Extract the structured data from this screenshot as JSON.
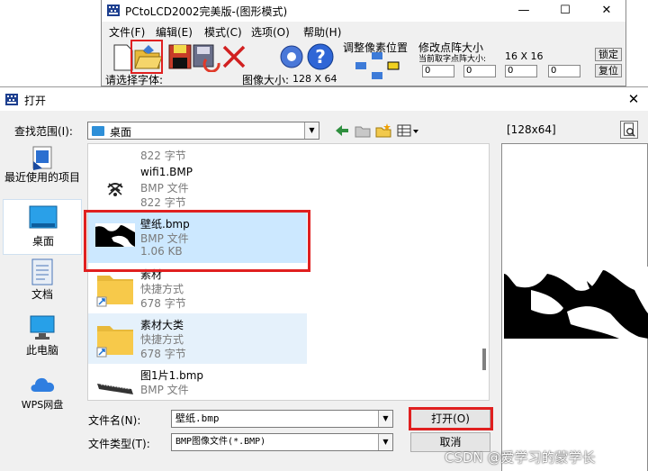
{
  "background_app": {
    "title": "PCtoLCD2002完美版-(图形模式)",
    "window_controls": [
      "—",
      "☐",
      "✕"
    ],
    "menu": [
      "文件(F)",
      "编辑(E)",
      "模式(C)",
      "选项(O)",
      "帮助(H)"
    ],
    "adjust_label": "调整像素位置",
    "resize_label": "修改点阵大小",
    "current_size_label": "当前取字点阵大小:",
    "current_size_value": "16 X 16",
    "lock_button": "锁定",
    "restore_button": "复位",
    "spin_values": [
      "0",
      "0",
      "0",
      "0"
    ],
    "status_font_label": "请选择字体:",
    "status_size_label": "图像大小:",
    "status_size_value": "128 X 64"
  },
  "dialog": {
    "title": "打开",
    "close_glyph": "✕",
    "look_in_label": "查找范围(I):",
    "look_in_value": "桌面",
    "preview_label": "[128x64]",
    "places": [
      {
        "label": "最近使用的项目",
        "icon": "recent-icon"
      },
      {
        "label": "桌面",
        "icon": "desktop-icon",
        "selected": true
      },
      {
        "label": "文档",
        "icon": "documents-icon"
      },
      {
        "label": "此电脑",
        "icon": "computer-icon"
      },
      {
        "label": "WPS网盘",
        "icon": "cloud-icon"
      }
    ],
    "files": [
      {
        "size": "822 字节"
      },
      {
        "name": "wifi1.BMP",
        "type": "BMP 文件",
        "size": "822 字节"
      },
      {
        "name": "壁纸.bmp",
        "type": "BMP 文件",
        "size": "1.06 KB"
      },
      {
        "name": "素材",
        "type": "快捷方式",
        "size": "678 字节"
      },
      {
        "name": "素材大类",
        "type": "快捷方式",
        "size": "678 字节"
      },
      {
        "name": "图1片1.bmp",
        "type": "BMP 文件"
      }
    ],
    "file_name_label": "文件名(N):",
    "file_name_value": "壁纸.bmp",
    "file_type_label": "文件类型(T):",
    "file_type_value": "BMP图像文件(*.BMP)",
    "open_button": "打开(O)",
    "cancel_button": "取消",
    "watermark": "CSDN @爱学习的蒙学长"
  },
  "colors": {
    "highlight_red": "#e02020",
    "selection_blue": "#cce8ff",
    "hover_blue": "#e5f1fb",
    "folder_yellow": "#f7c94a"
  }
}
